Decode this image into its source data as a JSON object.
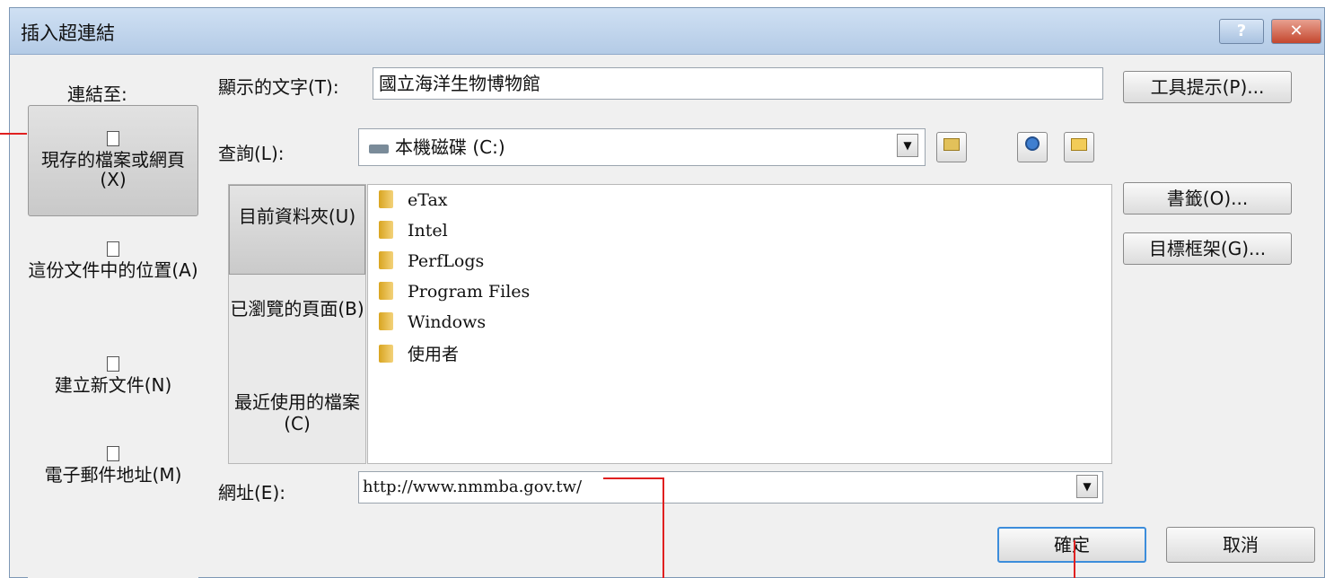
{
  "window": {
    "title": "插入超連結",
    "help": "?",
    "close": "✕"
  },
  "linkto": {
    "label": "連結至:",
    "items": [
      {
        "label": "現存的檔案或網頁(X)"
      },
      {
        "label": "這份文件中的位置(A)"
      },
      {
        "label": "建立新文件(N)"
      },
      {
        "label": "電子郵件地址(M)"
      }
    ]
  },
  "display_text": {
    "label": "顯示的文字(T):",
    "value": "國立海洋生物博物館"
  },
  "lookin": {
    "label": "查詢(L):",
    "value": "本機磁碟 (C:)"
  },
  "subnav": {
    "items": [
      {
        "label": "目前資料夾(U)"
      },
      {
        "label": "已瀏覽的頁面(B)"
      },
      {
        "label": "最近使用的檔案(C)"
      }
    ]
  },
  "files": [
    "eTax",
    "Intel",
    "PerfLogs",
    "Program Files",
    "Windows",
    "使用者"
  ],
  "address": {
    "label": "網址(E):",
    "value": "http://www.nmmba.gov.tw/"
  },
  "buttons": {
    "screentip": "工具提示(P)...",
    "bookmark": "書籤(O)...",
    "target_frame": "目標框架(G)...",
    "ok": "確定",
    "cancel": "取消"
  },
  "colors": {
    "annotation": "#e02020",
    "titlebar": "#b4cbe6",
    "default_button_border": "#3c8ddb"
  }
}
